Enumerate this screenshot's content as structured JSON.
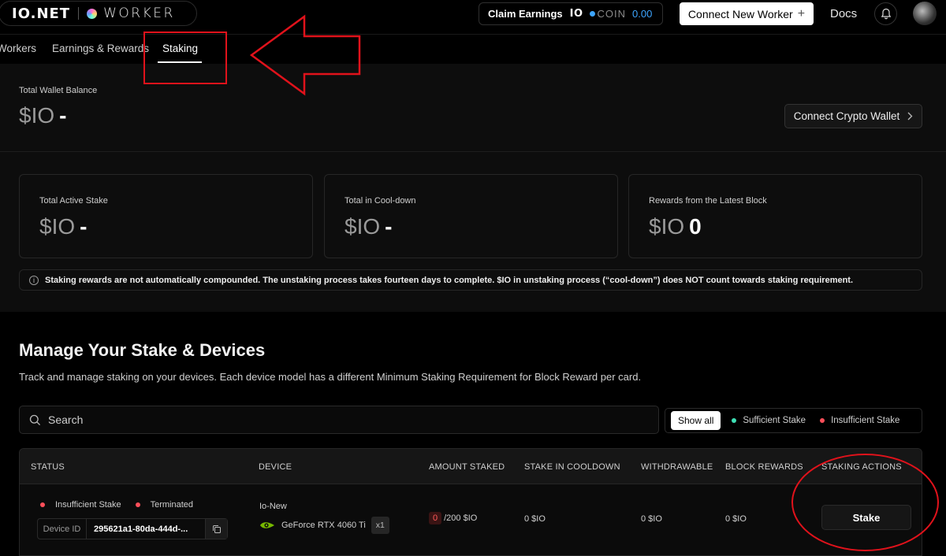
{
  "header": {
    "brand_io": "IO.NET",
    "brand_worker": "WORKER",
    "claim_label": "Claim Earnings",
    "claim_logo": "IO",
    "coin_text": "COIN",
    "coin_value": "0.00",
    "connect_worker_label": "Connect New Worker",
    "docs_label": "Docs",
    "bell_icon": "bell-icon",
    "avatar_icon": "avatar"
  },
  "nav": {
    "tabs": [
      {
        "label": "Workers"
      },
      {
        "label": "Earnings & Rewards"
      },
      {
        "label": "Staking",
        "active": true
      }
    ]
  },
  "wallet": {
    "label": "Total Wallet Balance",
    "currency": "$IO",
    "value": "-",
    "connect_label": "Connect Crypto Wallet"
  },
  "stats": [
    {
      "label": "Total Active Stake",
      "currency": "$IO",
      "value": "-"
    },
    {
      "label": "Total in Cool-down",
      "currency": "$IO",
      "value": "-"
    },
    {
      "label": "Rewards from the Latest Block",
      "currency": "$IO",
      "value": "0"
    }
  ],
  "info_text": "Staking rewards are not automatically compounded. The unstaking process takes fourteen days to complete. $IO in unstaking process (“cool-down”) does NOT count towards staking requirement.",
  "manage": {
    "title": "Manage Your Stake & Devices",
    "subtitle": "Track and manage staking on your devices. Each device model has a different Minimum Staking Requirement for Block Reward per card.",
    "search_placeholder": "Search",
    "filters": {
      "show_all": "Show all",
      "sufficient": "Sufficient Stake",
      "insufficient": "Insufficient Stake"
    }
  },
  "table": {
    "headers": [
      "STATUS",
      "DEVICE",
      "AMOUNT STAKED",
      "STAKE IN COOLDOWN",
      "WITHDRAWABLE",
      "BLOCK REWARDS",
      "STAKING ACTIONS"
    ],
    "rows": [
      {
        "status_stake": "Insufficient Stake",
        "status_state": "Terminated",
        "device_id_label": "Device ID",
        "device_id": "295621a1-80da-444d-...",
        "device_name": "Io-New",
        "gpu": "GeForce RTX 4060 Ti",
        "gpu_count": "x1",
        "amount_staked": "0",
        "amount_required": "/200 $IO",
        "cooldown": "0 $IO",
        "withdrawable": "0 $IO",
        "block_rewards": "0 $IO",
        "action": "Stake"
      }
    ]
  },
  "colors": {
    "accent_blue": "#3da5ff",
    "sufficient_green": "#3ee0b5",
    "insufficient_red": "#ff4f5a",
    "annotation_red": "#e0121b"
  }
}
